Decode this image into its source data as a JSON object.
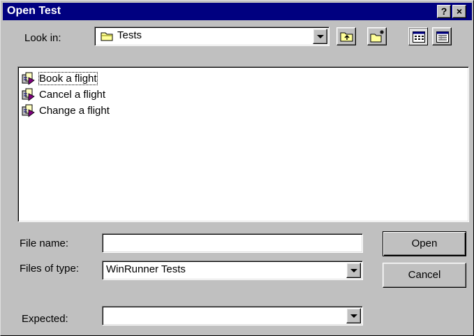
{
  "dialog": {
    "title": "Open Test",
    "help_button": "?",
    "close_button": "×"
  },
  "look_in": {
    "label": "Look in:",
    "value": "Tests"
  },
  "toolbar": {
    "up_one_level": "up-folder-icon",
    "create_new_folder": "new-folder-icon",
    "list_view": "list-view-icon",
    "details_view": "details-view-icon"
  },
  "files": [
    {
      "name": "Book a flight",
      "icon": "winrunner-test-icon",
      "focused": true
    },
    {
      "name": "Cancel a flight",
      "icon": "winrunner-test-icon",
      "focused": false
    },
    {
      "name": "Change a flight",
      "icon": "winrunner-test-icon",
      "focused": false
    }
  ],
  "file_name": {
    "label": "File name:",
    "value": ""
  },
  "file_type": {
    "label": "Files of type:",
    "value": "WinRunner Tests"
  },
  "expected": {
    "label": "Expected:",
    "value": ""
  },
  "buttons": {
    "open": "Open",
    "cancel": "Cancel"
  }
}
